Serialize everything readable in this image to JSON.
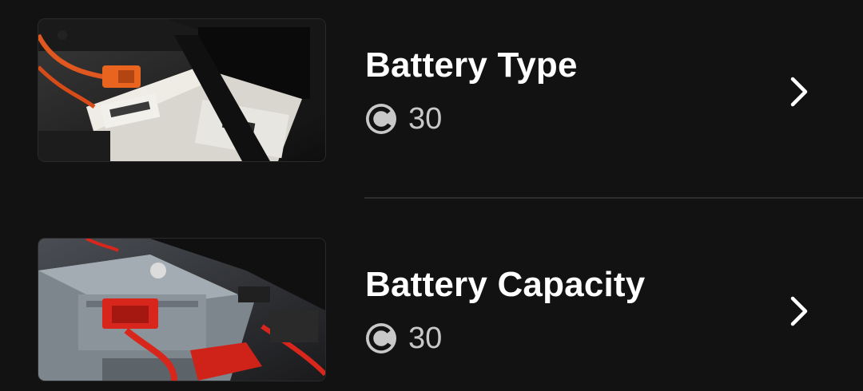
{
  "items": [
    {
      "title": "Battery Type",
      "price": "30",
      "coin_icon": "coin-c-icon",
      "chevron_icon": "chevron-right-icon",
      "image": "battery-under-trunk-orange-cable"
    },
    {
      "title": "Battery Capacity",
      "price": "30",
      "coin_icon": "coin-c-icon",
      "chevron_icon": "chevron-right-icon",
      "image": "battery-with-red-terminal-cover"
    }
  ],
  "colors": {
    "background": "#121212",
    "title": "#ffffff",
    "price": "#c8c8c8",
    "divider": "#2e2e2e"
  }
}
